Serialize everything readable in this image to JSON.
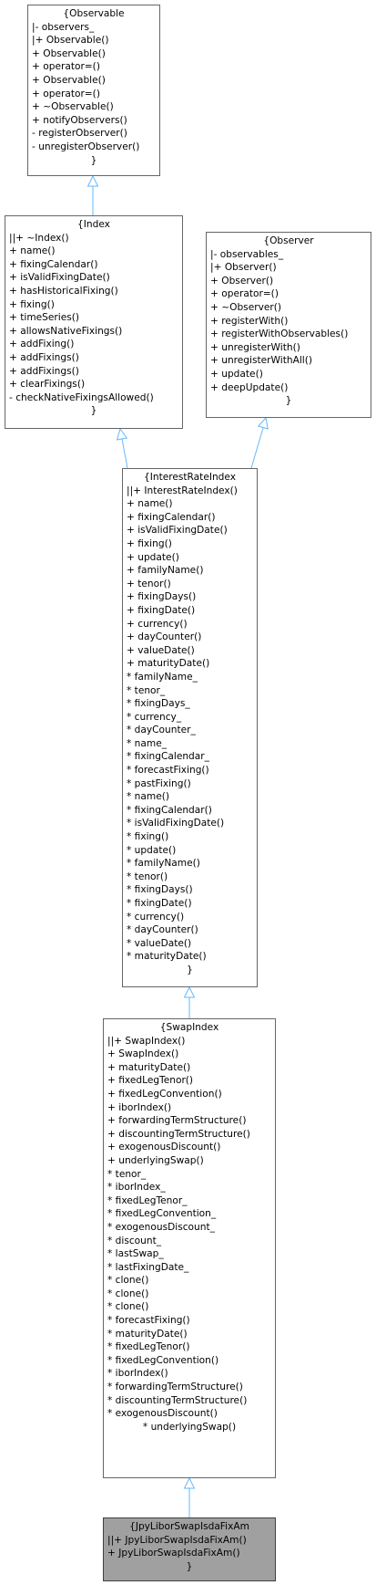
{
  "diagram": {
    "nodes": [
      {
        "id": "observable",
        "lines": [
          "{Observable",
          "|- observers_",
          "|+ Observable()",
          "+ Observable()",
          "+ operator=()",
          "+ Observable()",
          "+ operator=()",
          "+ ~Observable()",
          "+ notifyObservers()",
          "- registerObserver()",
          "- unregisterObserver()",
          "}"
        ]
      },
      {
        "id": "index",
        "lines": [
          "{Index",
          "||+ ~Index()",
          "+ name()",
          "+ fixingCalendar()",
          "+ isValidFixingDate()",
          "+ hasHistoricalFixing()",
          "+ fixing()",
          "+ timeSeries()",
          "+ allowsNativeFixings()",
          "+ addFixing()",
          "+ addFixings()",
          "+ addFixings()",
          "+ clearFixings()",
          "- checkNativeFixingsAllowed()",
          "}"
        ]
      },
      {
        "id": "observer",
        "lines": [
          "{Observer",
          "|- observables_",
          "|+ Observer()",
          "+ Observer()",
          "+ operator=()",
          "+ ~Observer()",
          "+ registerWith()",
          "+ registerWithObservables()",
          "+ unregisterWith()",
          "+ unregisterWithAll()",
          "+ update()",
          "+ deepUpdate()",
          "}"
        ]
      },
      {
        "id": "interest-rate-index",
        "lines": [
          "{InterestRateIndex",
          "||+ InterestRateIndex()",
          "+ name()",
          "+ fixingCalendar()",
          "+ isValidFixingDate()",
          "+ fixing()",
          "+ update()",
          "+ familyName()",
          "+ tenor()",
          "+ fixingDays()",
          "+ fixingDate()",
          "+ currency()",
          "+ dayCounter()",
          "+ valueDate()",
          "+ maturityDate()",
          "* familyName_",
          "* tenor_",
          "* fixingDays_",
          "* currency_",
          "* dayCounter_",
          "* name_",
          "* fixingCalendar_",
          "* forecastFixing()",
          "* pastFixing()",
          "* name()",
          "* fixingCalendar()",
          "* isValidFixingDate()",
          "* fixing()",
          "* update()",
          "* familyName()",
          "* tenor()",
          "* fixingDays()",
          "* fixingDate()",
          "* currency()",
          "* dayCounter()",
          "* valueDate()",
          "* maturityDate()",
          "}"
        ]
      },
      {
        "id": "swap-index",
        "lines": [
          "{SwapIndex",
          "||+ SwapIndex()",
          "+ SwapIndex()",
          "+ maturityDate()",
          "+ fixedLegTenor()",
          "+ fixedLegConvention()",
          "+ iborIndex()",
          "+ forwardingTermStructure()",
          "+ discountingTermStructure()",
          "+ exogenousDiscount()",
          "+ underlyingSwap()",
          "* tenor_",
          "* iborIndex_",
          "* fixedLegTenor_",
          "* fixedLegConvention_",
          "* exogenousDiscount_",
          "* discount_",
          "* lastSwap_",
          "* lastFixingDate_",
          "* clone()",
          "* clone()",
          "* clone()",
          "* forecastFixing()",
          "* maturityDate()",
          "* fixedLegTenor()",
          "* fixedLegConvention()",
          "* iborIndex()",
          "* forwardingTermStructure()",
          "* discountingTermStructure()",
          "* exogenousDiscount()",
          "* underlyingSwap()",
          "}"
        ]
      },
      {
        "id": "jpy-libor-swap-isda-fix-am",
        "lines": [
          "{JpyLiborSwapIsdaFixAm",
          "||+ JpyLiborSwapIsdaFixAm()",
          "+ JpyLiborSwapIsdaFixAm()",
          "}"
        ]
      }
    ],
    "edges": [
      {
        "from": "index",
        "to": "observable"
      },
      {
        "from": "interest-rate-index",
        "to": "index"
      },
      {
        "from": "interest-rate-index",
        "to": "observer"
      },
      {
        "from": "swap-index",
        "to": "interest-rate-index"
      },
      {
        "from": "jpy-libor-swap-isda-fix-am",
        "to": "swap-index"
      }
    ],
    "colors": {
      "edge": "#63b8ff",
      "node_border": "#666666",
      "node_fill": "#ffffff",
      "highlight_fill": "#a0a0a0"
    }
  }
}
